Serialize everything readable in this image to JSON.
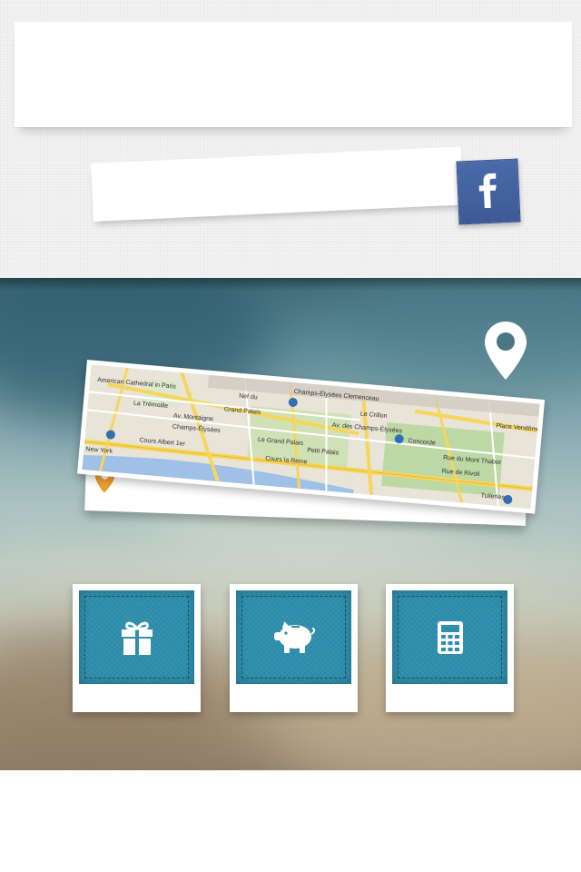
{
  "header": {
    "title": ""
  },
  "facebook": {
    "label": "",
    "icon": "facebook-icon",
    "color": "#3b5998"
  },
  "location": {
    "pin_icon": "map-pin-icon",
    "pin_color": "#ffffff"
  },
  "map_card": {
    "map_labels": [
      "Champs-Élysées",
      "Grand Palais",
      "Petit Palais",
      "Le Grand Palais",
      "Cours la Reine",
      "Cours Albert 1er",
      "Concorde",
      "Place Vendôme",
      "Tuileries",
      "Le Crillon",
      "Champs-Élysées Clemenceau",
      "La Trémoille",
      "American Cathedral in Paris",
      "Rue du Mont Thabor",
      "Rue de Rivoli",
      "Av. Montaigne",
      "Av. des Champs-Élysées",
      "New York",
      "Nef du"
    ],
    "address": "",
    "address_pin_icon": "location-pin-icon",
    "address_pin_color": "#f0a030"
  },
  "tiles": [
    {
      "icon": "gift-icon",
      "label": ""
    },
    {
      "icon": "piggy-bank-icon",
      "label": ""
    },
    {
      "icon": "calculator-icon",
      "label": ""
    }
  ],
  "colors": {
    "tile_blue": "#2e8fad",
    "facebook_blue": "#3b5998",
    "pin_orange": "#f0a030"
  }
}
